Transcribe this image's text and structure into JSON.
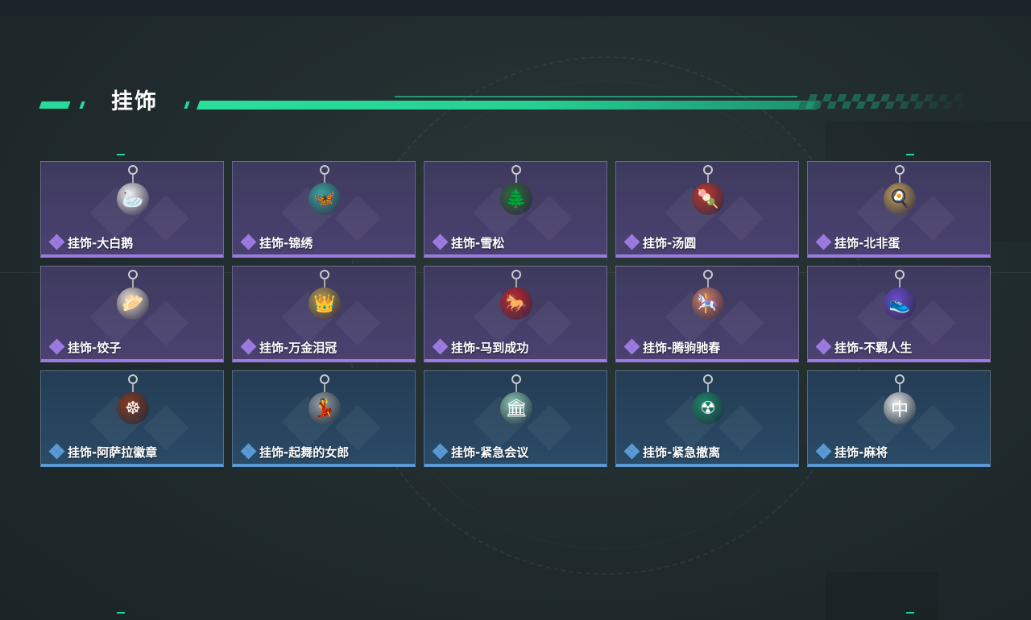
{
  "section": {
    "title": "挂饰"
  },
  "colors": {
    "accent_green": "#29d89b",
    "rarity_purple": "#9c7ae0",
    "rarity_blue": "#5a99d4"
  },
  "items": [
    {
      "name": "挂饰-大白鹅",
      "rarity": "purple",
      "icon": "goose-charm-icon",
      "charm_color": "#f2f2f2",
      "glyph": "🦢"
    },
    {
      "name": "挂饰-锦绣",
      "rarity": "purple",
      "icon": "butterfly-charm-icon",
      "charm_color": "#3aa6a0",
      "glyph": "🦋"
    },
    {
      "name": "挂饰-雪松",
      "rarity": "purple",
      "icon": "pine-tree-charm-icon",
      "charm_color": "#2f6a3a",
      "glyph": "🌲"
    },
    {
      "name": "挂饰-汤圆",
      "rarity": "purple",
      "icon": "rice-ball-bowl-charm-icon",
      "charm_color": "#c0392b",
      "glyph": "🍡"
    },
    {
      "name": "挂饰-北非蛋",
      "rarity": "purple",
      "icon": "shakshuka-charm-icon",
      "charm_color": "#c8a25a",
      "glyph": "🍳"
    },
    {
      "name": "挂饰-饺子",
      "rarity": "purple",
      "icon": "dumpling-plate-charm-icon",
      "charm_color": "#e8e1d6",
      "glyph": "🥟"
    },
    {
      "name": "挂饰-万金泪冠",
      "rarity": "purple",
      "icon": "jeweled-crown-charm-icon",
      "charm_color": "#b49a52",
      "glyph": "👑"
    },
    {
      "name": "挂饰-马到成功",
      "rarity": "purple",
      "icon": "red-horse-charm-icon",
      "charm_color": "#c8262c",
      "glyph": "🐎"
    },
    {
      "name": "挂饰-腾驹驰春",
      "rarity": "purple",
      "icon": "carriage-charm-icon",
      "charm_color": "#d4806a",
      "glyph": "🎠"
    },
    {
      "name": "挂饰-不羁人生",
      "rarity": "purple",
      "icon": "sneaker-charm-icon",
      "charm_color": "#6a4bd1",
      "glyph": "👟"
    },
    {
      "name": "挂饰-阿萨拉徽章",
      "rarity": "blue",
      "icon": "ship-wheel-badge-icon",
      "charm_color": "#8a3a22",
      "glyph": "☸"
    },
    {
      "name": "挂饰-起舞的女郎",
      "rarity": "blue",
      "icon": "dancer-figurine-icon",
      "charm_color": "#9aa0a6",
      "glyph": "💃"
    },
    {
      "name": "挂饰-紧急会议",
      "rarity": "blue",
      "icon": "meeting-emblem-icon",
      "charm_color": "#8fc8b8",
      "glyph": "🏛"
    },
    {
      "name": "挂饰-紧急撤离",
      "rarity": "blue",
      "icon": "evacuation-tag-icon",
      "charm_color": "#1f8a6a",
      "glyph": "☢"
    },
    {
      "name": "挂饰-麻将",
      "rarity": "blue",
      "icon": "mahjong-tile-charm-icon",
      "charm_color": "#eaeaea",
      "glyph": "中"
    }
  ]
}
